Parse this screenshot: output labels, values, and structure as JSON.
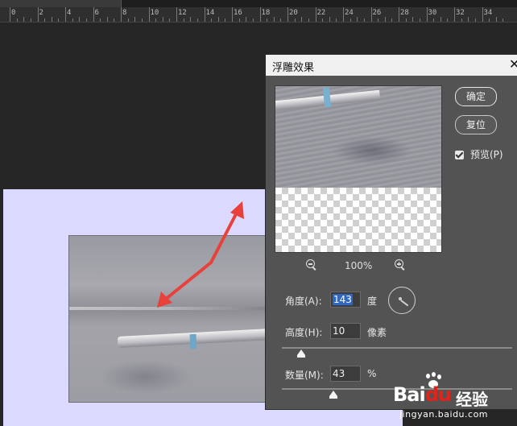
{
  "ruler": {
    "labels": [
      "0",
      "2",
      "4",
      "6",
      "8",
      "10",
      "12",
      "14",
      "16",
      "18",
      "20",
      "22",
      "24",
      "26",
      "28",
      "30",
      "32",
      "34"
    ]
  },
  "dialog": {
    "title": "浮雕效果",
    "close_glyph": "✕",
    "ok_label": "确定",
    "reset_label": "复位",
    "preview_label": "预览(P)",
    "preview_checked": true,
    "zoom": "100%",
    "angle": {
      "label": "角度(A):",
      "value": "143",
      "unit": "度"
    },
    "height": {
      "label": "高度(H):",
      "value": "10",
      "unit": "像素"
    },
    "amount": {
      "label": "数量(M):",
      "value": "43",
      "unit": "%"
    }
  },
  "icons": {
    "zoom_out": "zoom-out-icon",
    "zoom_in": "zoom-in-icon",
    "angle_dial": "angle-dial-icon"
  },
  "colors": {
    "canvas_bg": "#dcd9ff",
    "dialog_bg": "#535353",
    "arrow": "#e8403a",
    "selection": "#2d66c4"
  },
  "watermark": {
    "brand_a": "Bai",
    "brand_b": "du",
    "cn": "经验",
    "url": "jingyan.baidu.com"
  }
}
